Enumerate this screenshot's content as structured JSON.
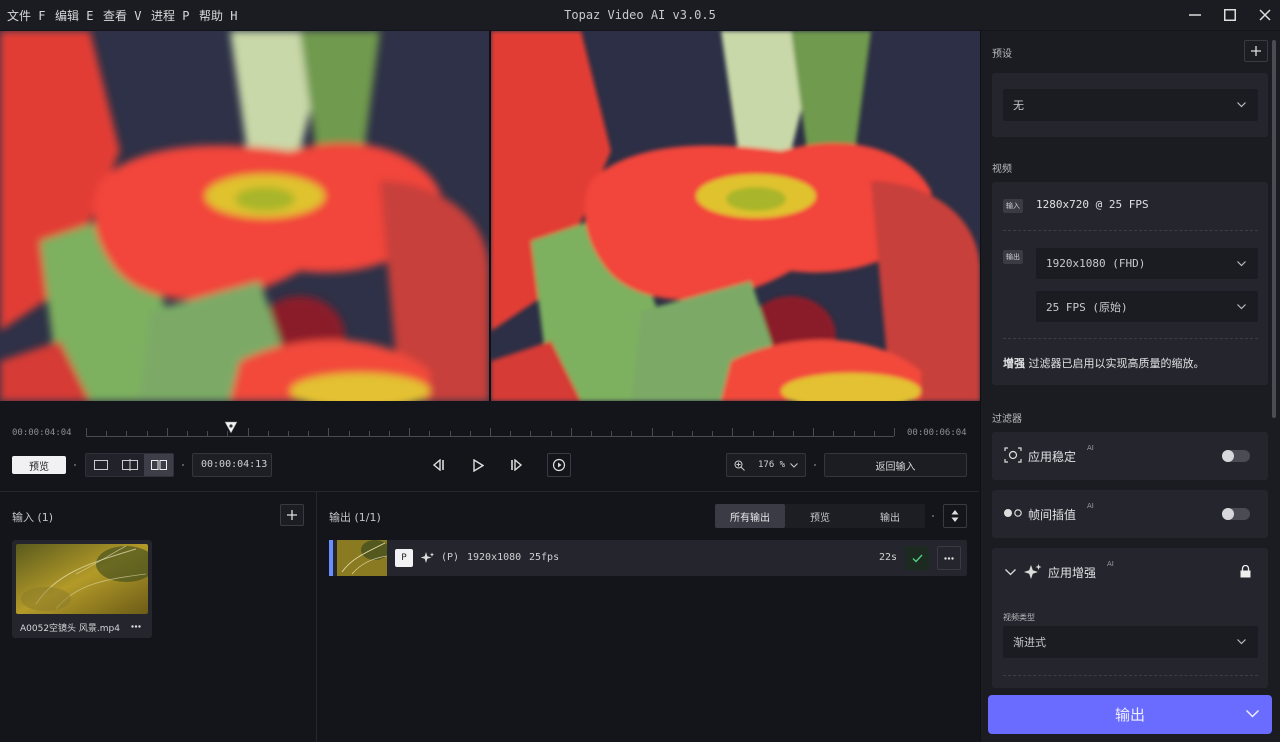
{
  "menu": [
    "文件 F",
    "编辑 E",
    "查看 V",
    "进程 P",
    "帮助 H"
  ],
  "app_title": "Topaz Video AI  v3.0.5",
  "timeline": {
    "start": "00:00:04:04",
    "end": "00:00:06:04",
    "playhead_progress": 0.18
  },
  "controls": {
    "preview_label": "预览",
    "current_time": "00:00:04:13",
    "zoom": "176 %",
    "return_label": "返回输入"
  },
  "input_panel": {
    "title": "输入 (1)",
    "file_name": "A0052空镜头 风景.mp4"
  },
  "output_panel": {
    "title": "输出 (1/1)",
    "tabs": [
      "所有输出",
      "预览",
      "输出"
    ],
    "row": {
      "badge": "P",
      "tag": "(P)",
      "resolution": "1920x1080",
      "fps": "25fps",
      "duration": "22s"
    }
  },
  "right_panel": {
    "presets_label": "预设",
    "preset_value": "无",
    "video_label": "视频",
    "input_badge": "输入",
    "input_info": "1280x720 @ 25 FPS",
    "output_badge": "输出",
    "output_resolution": "1920x1080 (FHD)",
    "output_fps": "25 FPS (原始)",
    "enhance_note_bold": "增强",
    "enhance_note": " 过滤器已启用以实现高质量的缩放。",
    "filters_label": "过滤器",
    "filters": [
      {
        "name": "应用稳定",
        "ai": "AI",
        "enabled": false
      },
      {
        "name": "帧间插值",
        "ai": "AI",
        "enabled": false
      },
      {
        "name": "应用增强",
        "ai": "AI",
        "enabled": true
      }
    ],
    "video_type_label": "视频类型",
    "video_type_value": "渐进式",
    "export_label": "输出"
  }
}
